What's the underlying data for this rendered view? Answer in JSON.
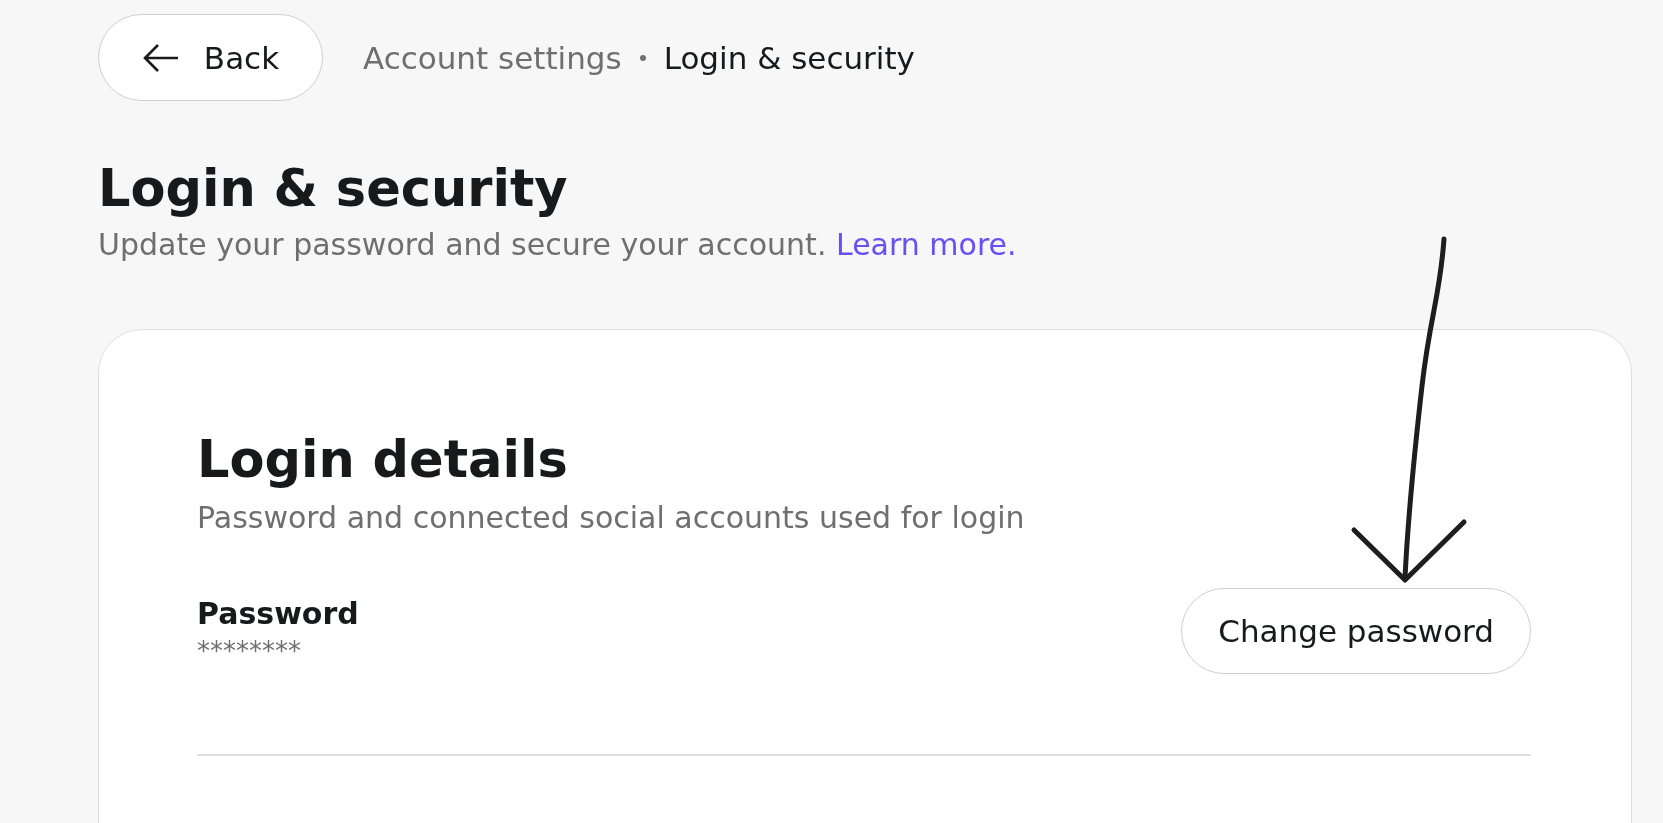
{
  "back_button": {
    "label": "Back"
  },
  "breadcrumb": [
    {
      "label": "Account settings",
      "selected": false
    },
    {
      "label": "Login & security",
      "selected": true
    }
  ],
  "header": {
    "title": "Login & security",
    "subtitle": "Update your password and secure your account.",
    "link": "Learn more."
  },
  "section": {
    "title": "Login details",
    "description": "Password and connected social accounts used for login",
    "rows": [
      {
        "label": "Password",
        "value": "********",
        "action": "Change password"
      }
    ]
  }
}
